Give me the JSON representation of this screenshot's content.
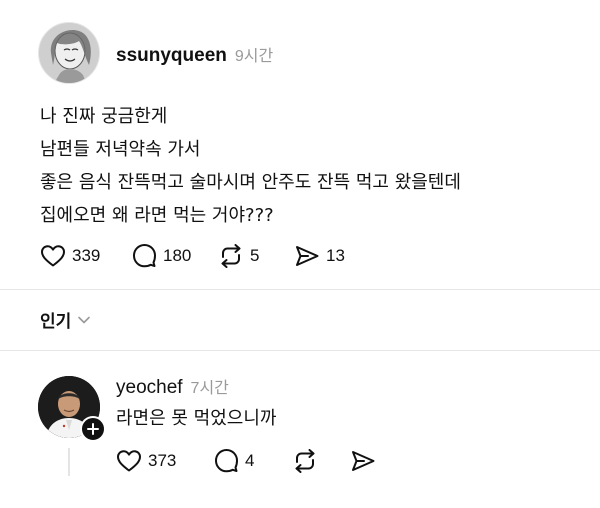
{
  "post": {
    "username": "ssunyqueen",
    "time": "9시간",
    "lines": [
      "나 진짜 궁금한게",
      "남편들 저녁약속 가서",
      "좋은 음식 잔뜩먹고 술마시며 안주도 잔뜩 먹고 왔을텐데",
      "집에오면 왜 라면 먹는 거야???"
    ],
    "likes": "339",
    "comments": "180",
    "reposts": "5",
    "shares": "13"
  },
  "sort": {
    "label": "인기"
  },
  "reply": {
    "username": "yeochef",
    "time": "7시간",
    "text": "라면은 못 먹었으니까",
    "likes": "373",
    "comments": "4"
  }
}
